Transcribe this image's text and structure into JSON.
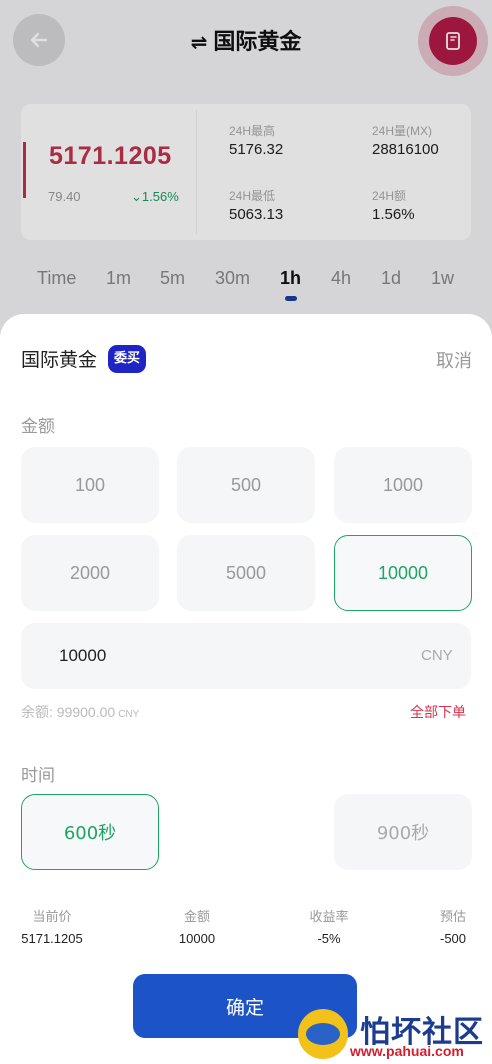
{
  "header": {
    "title": "国际黄金",
    "swap_icon": "⇌"
  },
  "quote": {
    "price": "5171.1205",
    "change": "79.40",
    "change_pct": "1.56%",
    "high_label": "24H最高",
    "high_value": "5176.32",
    "volume_label": "24H量(MX)",
    "volume_value": "28816100",
    "low_label": "24H最低",
    "low_value": "5063.13",
    "amount_label": "24H额",
    "amount_value": "1.56%"
  },
  "timeframes": [
    "Time",
    "1m",
    "5m",
    "30m",
    "1h",
    "4h",
    "1d",
    "1w"
  ],
  "selected_timeframe": "1h",
  "sheet": {
    "title": "国际黄金",
    "badge": "委买",
    "cancel": "取消",
    "amount_label": "金额",
    "amount_options": [
      "100",
      "500",
      "1000",
      "2000",
      "5000",
      "10000"
    ],
    "selected_amount": "10000",
    "input_value": "10000",
    "input_unit": "CNY",
    "balance_label": "余额:",
    "balance_value": "99900.00",
    "balance_unit": "CNY",
    "all_order": "全部下单",
    "time_label": "时间",
    "time_options": [
      "600秒",
      "900秒"
    ],
    "selected_time": "600秒",
    "summary": [
      {
        "label": "当前价",
        "value": "5171.1205"
      },
      {
        "label": "金额",
        "value": "10000"
      },
      {
        "label": "收益率",
        "value": "-5%"
      },
      {
        "label": "预估",
        "value": "-500"
      }
    ],
    "confirm": "确定"
  },
  "watermark": {
    "text": "怕坏社区",
    "url": "www.pahuai.com"
  },
  "colors": {
    "accent_green": "#1fa463",
    "price_red": "#c2334d",
    "confirm_blue": "#1c54c7",
    "badge_blue": "#1f24c5"
  }
}
